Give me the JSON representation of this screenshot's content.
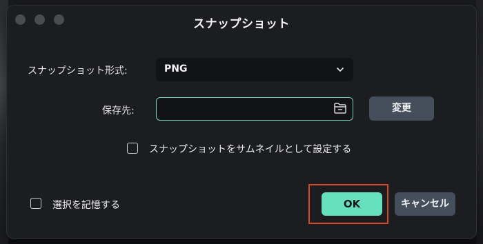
{
  "window": {
    "title": "スナップショット"
  },
  "format": {
    "label": "スナップショット形式:",
    "selected": "PNG"
  },
  "save_location": {
    "label": "保存先:",
    "value": "",
    "change_button": "変更"
  },
  "thumbnail_option": {
    "label": "スナップショットをサムネイルとして設定する",
    "checked": false
  },
  "remember_option": {
    "label": "選択を記憶する",
    "checked": false
  },
  "buttons": {
    "ok": "OK",
    "cancel": "キャンセル"
  },
  "colors": {
    "accent": "#66e0bf",
    "secondary_button": "#454f5c",
    "dialog_bg": "#1c1d20",
    "field_bg": "#121316",
    "highlight_border": "#d64a2c"
  },
  "icons": {
    "format_dropdown": "chevron-down-icon",
    "path_picker": "folder-icon"
  }
}
